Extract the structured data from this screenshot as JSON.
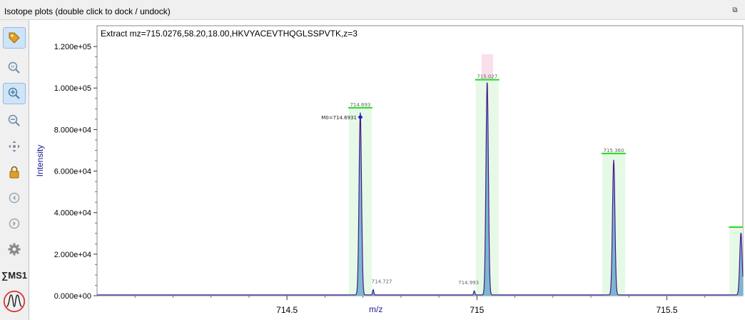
{
  "panel": {
    "title": "Isotope plots (double click to dock / undock)"
  },
  "toolbar": {
    "tools": [
      {
        "icon": "tag-icon",
        "active": true
      },
      {
        "icon": "zoom-reset-icon",
        "active": false
      },
      {
        "icon": "zoom-in-icon",
        "active": true
      },
      {
        "icon": "zoom-out-icon",
        "active": false
      },
      {
        "icon": "pan-icon",
        "active": false
      },
      {
        "icon": "lock-icon",
        "active": false
      },
      {
        "icon": "back-icon",
        "active": false
      },
      {
        "icon": "forward-icon",
        "active": false
      },
      {
        "icon": "gear-icon",
        "active": false
      },
      {
        "icon": "ms1-sum-icon",
        "active": false,
        "label": "∑MS1"
      },
      {
        "icon": "peak-icon",
        "active": false
      }
    ]
  },
  "colors": {
    "trace": "#4a1a8c",
    "fill": "#5fa7c9",
    "band": "#e6f9e6",
    "marker": "#22dd22",
    "selected_band": "#f7d6e6",
    "axis_label": "#1a1a8c"
  },
  "chart_data": {
    "type": "line",
    "title": "Extract mz=715.0276,58.20,18.00,HKVYACEVTHQGLSSPVTK,z=3",
    "xlabel": "m/z",
    "ylabel": "Intensity",
    "xlim": [
      714.0,
      715.7
    ],
    "ylim": [
      0,
      130000
    ],
    "xticks": [
      714.5,
      715,
      715.5
    ],
    "xtick_labels": [
      "714.5",
      "715",
      "715.5"
    ],
    "yticks": [
      0,
      20000,
      40000,
      60000,
      80000,
      100000,
      120000
    ],
    "ytick_labels": [
      "0.000e+00",
      "2.000e+04",
      "4.000e+04",
      "6.000e+04",
      "8.000e+04",
      "1.000e+05",
      "1.200e+05"
    ],
    "peaks": [
      {
        "x": 714.693,
        "y": 88000,
        "label": "714.693",
        "expected": 90500
      },
      {
        "x": 715.027,
        "y": 103000,
        "label": "715.027",
        "expected": 104000
      },
      {
        "x": 715.36,
        "y": 65000,
        "label": "715.360",
        "expected": 68500
      },
      {
        "x": 715.695,
        "y": 30000,
        "label": "",
        "expected": 33000
      }
    ],
    "minor_peaks": [
      {
        "x": 714.727,
        "y": 2500,
        "label": "714.727"
      },
      {
        "x": 714.993,
        "y": 2000,
        "label": "714.993"
      }
    ],
    "annotation": {
      "text": "M0=714.6931",
      "x": 714.6931,
      "y": 86000
    },
    "selected_x": 715.0276
  }
}
